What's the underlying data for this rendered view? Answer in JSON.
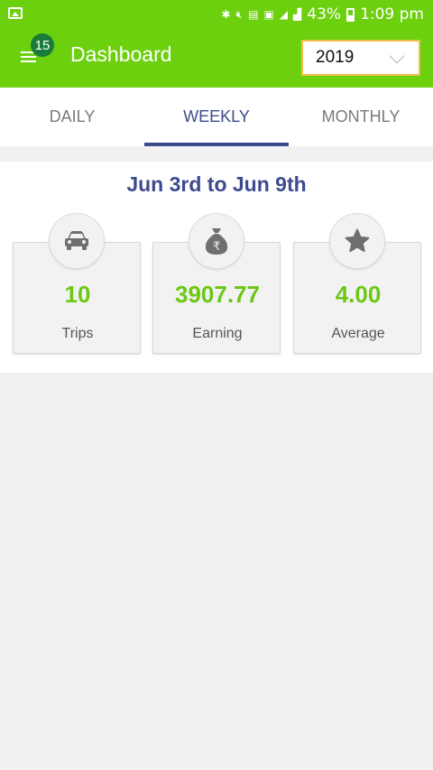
{
  "status_bar": {
    "battery": "43%",
    "time": "1:09 pm"
  },
  "app_bar": {
    "title": "Dashboard",
    "notification_count": "15",
    "year_select": "2019"
  },
  "tabs": [
    {
      "label": "DAILY",
      "active": false
    },
    {
      "label": "WEEKLY",
      "active": true
    },
    {
      "label": "MONTHLY",
      "active": false
    }
  ],
  "summary": {
    "date_range": "Jun 3rd  to Jun 9th",
    "cards": [
      {
        "icon": "car-icon",
        "value": "10",
        "label": "Trips"
      },
      {
        "icon": "money-bag-icon",
        "value": "3907.77",
        "label": "Earning"
      },
      {
        "icon": "star-icon",
        "value": "4.00",
        "label": "Average"
      }
    ]
  },
  "colors": {
    "primary_green": "#6dd00f",
    "accent_indigo": "#3d4a8e",
    "value_green": "#6cc814",
    "badge_green": "#1b7c3a"
  }
}
